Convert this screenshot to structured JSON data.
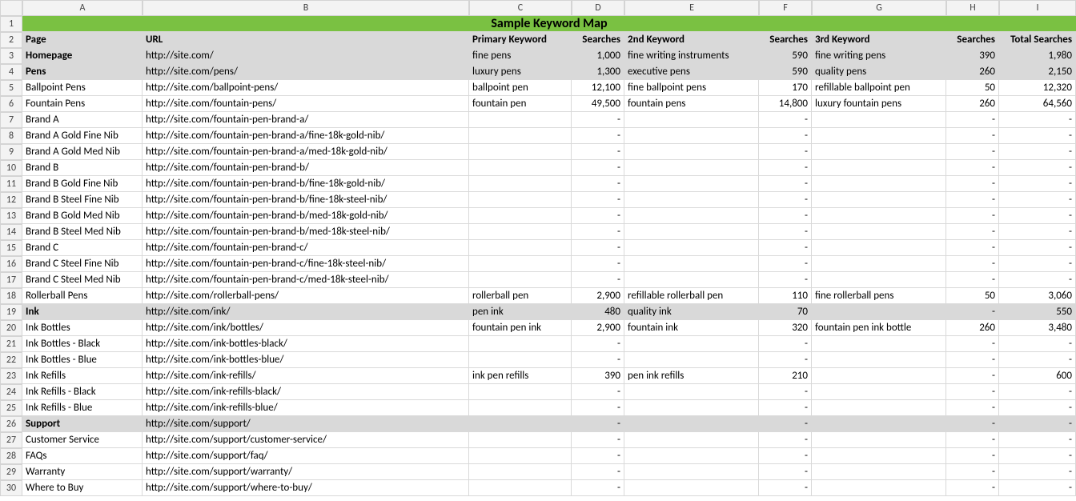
{
  "columns": [
    "A",
    "B",
    "C",
    "D",
    "E",
    "F",
    "G",
    "H",
    "I"
  ],
  "title": "Sample Keyword Map",
  "headers": [
    "Page",
    "URL",
    "Primary Keyword",
    "Searches",
    "2nd Keyword",
    "Searches",
    "3rd Keyword",
    "Searches",
    "Total Searches"
  ],
  "rows": [
    {
      "n": 3,
      "section": true,
      "bold": true,
      "cells": [
        "Homepage",
        "http://site.com/",
        "fine pens",
        "1,000",
        "fine writing instruments",
        "590",
        "fine writing pens",
        "390",
        "1,980"
      ]
    },
    {
      "n": 4,
      "section": true,
      "bold": true,
      "cells": [
        "Pens",
        "http://site.com/pens/",
        "luxury pens",
        "1,300",
        "executive pens",
        "590",
        "quality pens",
        "260",
        "2,150"
      ]
    },
    {
      "n": 5,
      "cells": [
        "Ballpoint Pens",
        "http://site.com/ballpoint-pens/",
        "ballpoint pen",
        "12,100",
        "fine ballpoint pens",
        "170",
        "refillable ballpoint pen",
        "50",
        "12,320"
      ]
    },
    {
      "n": 6,
      "cells": [
        "Fountain Pens",
        "http://site.com/fountain-pens/",
        "fountain pen",
        "49,500",
        "fountain pens",
        "14,800",
        "luxury fountain pens",
        "260",
        "64,560"
      ]
    },
    {
      "n": 7,
      "cells": [
        "Brand A",
        "http://site.com/fountain-pen-brand-a/",
        "",
        "-",
        "",
        "-",
        "",
        "-",
        "-"
      ]
    },
    {
      "n": 8,
      "cells": [
        "Brand A Gold Fine Nib",
        "http://site.com/fountain-pen-brand-a/fine-18k-gold-nib/",
        "",
        "-",
        "",
        "-",
        "",
        "-",
        "-"
      ]
    },
    {
      "n": 9,
      "cells": [
        "Brand A Gold Med Nib",
        "http://site.com/fountain-pen-brand-a/med-18k-gold-nib/",
        "",
        "-",
        "",
        "-",
        "",
        "-",
        "-"
      ]
    },
    {
      "n": 10,
      "cells": [
        "Brand B",
        "http://site.com/fountain-pen-brand-b/",
        "",
        "-",
        "",
        "-",
        "",
        "-",
        "-"
      ]
    },
    {
      "n": 11,
      "cells": [
        "Brand B Gold Fine Nib",
        "http://site.com/fountain-pen-brand-b/fine-18k-gold-nib/",
        "",
        "-",
        "",
        "-",
        "",
        "-",
        "-"
      ]
    },
    {
      "n": 12,
      "cells": [
        "Brand B Steel Fine Nib",
        "http://site.com/fountain-pen-brand-b/fine-18k-steel-nib/",
        "",
        "-",
        "",
        "-",
        "",
        "-",
        "-"
      ]
    },
    {
      "n": 13,
      "cells": [
        "Brand B Gold Med Nib",
        "http://site.com/fountain-pen-brand-b/med-18k-gold-nib/",
        "",
        "-",
        "",
        "-",
        "",
        "-",
        "-"
      ]
    },
    {
      "n": 14,
      "cells": [
        "Brand B Steel Med Nib",
        "http://site.com/fountain-pen-brand-b/med-18k-steel-nib/",
        "",
        "-",
        "",
        "-",
        "",
        "-",
        "-"
      ]
    },
    {
      "n": 15,
      "cells": [
        "Brand C",
        "http://site.com/fountain-pen-brand-c/",
        "",
        "-",
        "",
        "-",
        "",
        "-",
        "-"
      ]
    },
    {
      "n": 16,
      "cells": [
        "Brand C Steel Fine Nib",
        "http://site.com/fountain-pen-brand-c/fine-18k-steel-nib/",
        "",
        "-",
        "",
        "-",
        "",
        "-",
        "-"
      ]
    },
    {
      "n": 17,
      "cells": [
        "Brand C Steel Med Nib",
        "http://site.com/fountain-pen-brand-c/med-18k-steel-nib/",
        "",
        "-",
        "",
        "-",
        "",
        "-",
        "-"
      ]
    },
    {
      "n": 18,
      "cells": [
        "Rollerball Pens",
        "http://site.com/rollerball-pens/",
        "rollerball pen",
        "2,900",
        "refillable rollerball pen",
        "110",
        "fine rollerball pens",
        "50",
        "3,060"
      ]
    },
    {
      "n": 19,
      "section": true,
      "bold": true,
      "cells": [
        "Ink",
        "http://site.com/ink/",
        "pen ink",
        "480",
        "quality ink",
        "70",
        "",
        "-",
        "550"
      ]
    },
    {
      "n": 20,
      "cells": [
        "Ink Bottles",
        "http://site.com/ink/bottles/",
        "fountain pen ink",
        "2,900",
        "fountain ink",
        "320",
        "fountain pen ink bottle",
        "260",
        "3,480"
      ]
    },
    {
      "n": 21,
      "cells": [
        "Ink Bottles - Black",
        "http://site.com/ink-bottles-black/",
        "",
        "-",
        "",
        "-",
        "",
        "-",
        "-"
      ]
    },
    {
      "n": 22,
      "cells": [
        "Ink Bottles - Blue",
        "http://site.com/ink-bottles-blue/",
        "",
        "-",
        "",
        "-",
        "",
        "-",
        "-"
      ]
    },
    {
      "n": 23,
      "cells": [
        "Ink Refills",
        "http://site.com/ink-refills/",
        "ink pen refills",
        "390",
        "pen ink refills",
        "210",
        "",
        "-",
        "600"
      ]
    },
    {
      "n": 24,
      "cells": [
        "Ink Refills - Black",
        "http://site.com/ink-refills-black/",
        "",
        "-",
        "",
        "-",
        "",
        "-",
        "-"
      ]
    },
    {
      "n": 25,
      "cells": [
        "Ink Refills - Blue",
        "http://site.com/ink-refills-blue/",
        "",
        "-",
        "",
        "-",
        "",
        "-",
        "-"
      ]
    },
    {
      "n": 26,
      "section": true,
      "bold": true,
      "cells": [
        "Support",
        "http://site.com/support/",
        "",
        "-",
        "",
        "-",
        "",
        "-",
        "-"
      ]
    },
    {
      "n": 27,
      "cells": [
        "Customer Service",
        "http://site.com/support/customer-service/",
        "",
        "-",
        "",
        "-",
        "",
        "-",
        "-"
      ]
    },
    {
      "n": 28,
      "cells": [
        "FAQs",
        "http://site.com/support/faq/",
        "",
        "-",
        "",
        "-",
        "",
        "-",
        "-"
      ]
    },
    {
      "n": 29,
      "cells": [
        "Warranty",
        "http://site.com/support/warranty/",
        "",
        "-",
        "",
        "-",
        "",
        "-",
        "-"
      ]
    },
    {
      "n": 30,
      "cells": [
        "Where to Buy",
        "http://site.com/support/where-to-buy/",
        "",
        "-",
        "",
        "-",
        "",
        "-",
        "-"
      ]
    }
  ]
}
